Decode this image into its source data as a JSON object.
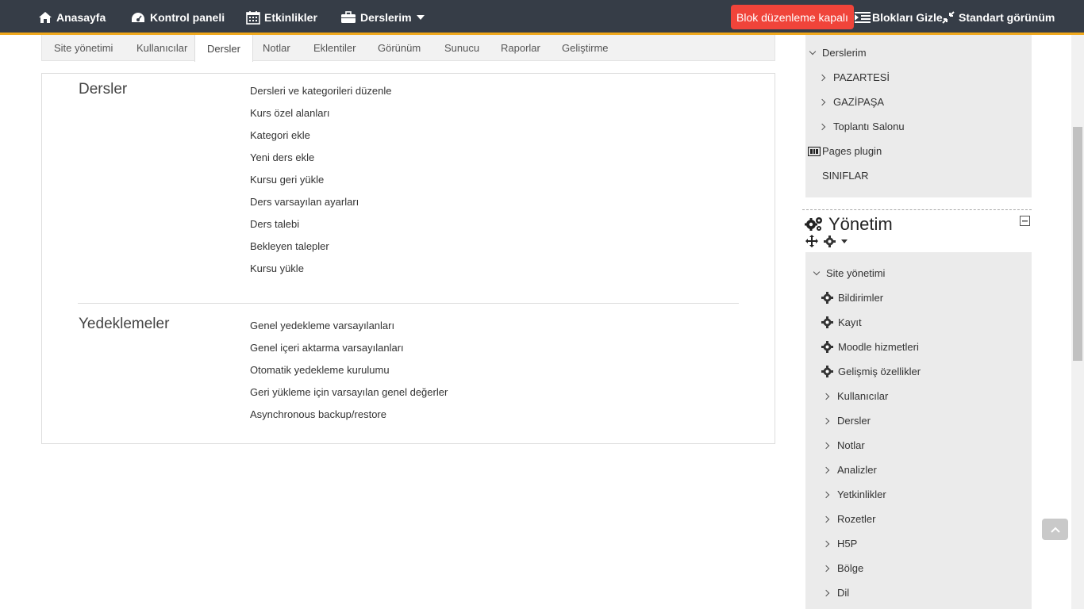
{
  "navbar": {
    "home": "Anasayfa",
    "dashboard": "Kontrol paneli",
    "events": "Etkinlikler",
    "mycourses": "Derslerim",
    "block_edit": "Blok düzenleme kapalı",
    "hide_blocks": "Blokları Gizle",
    "standard_view": "Standart görünüm"
  },
  "tabs": [
    "Site yönetimi",
    "Kullanıcılar",
    "Dersler",
    "Notlar",
    "Eklentiler",
    "Görünüm",
    "Sunucu",
    "Raporlar",
    "Geliştirme"
  ],
  "sections": {
    "courses": {
      "title": "Dersler",
      "links": [
        "Dersleri ve kategorileri düzenle",
        "Kurs özel alanları",
        "Kategori ekle",
        "Yeni ders ekle",
        "Kursu geri yükle",
        "Ders varsayılan ayarları",
        "Ders talebi",
        "Bekleyen talepler",
        "Kursu yükle"
      ]
    },
    "backups": {
      "title": "Yedeklemeler",
      "links": [
        "Genel yedekleme varsayılanları",
        "Genel içeri aktarma varsayılanları",
        "Otomatik yedekleme kurulumu",
        "Geri yükleme için varsayılan genel değerler",
        "Asynchronous backup/restore"
      ]
    }
  },
  "nav_block": {
    "mycourses": "Derslerim",
    "courses": [
      "PAZARTESİ",
      "GAZİPAŞA",
      "Toplantı Salonu"
    ],
    "pages_plugin": "Pages plugin",
    "siniflar": "SINIFLAR"
  },
  "admin_block": {
    "title": "Yönetim",
    "root": "Site yönetimi",
    "gear_items": [
      "Bildirimler",
      "Kayıt",
      "Moodle hizmetleri",
      "Gelişmiş özellikler"
    ],
    "folder_items": [
      "Kullanıcılar",
      "Dersler",
      "Notlar",
      "Analizler",
      "Yetkinlikler",
      "Rozetler",
      "H5P",
      "Bölge",
      "Dil"
    ]
  }
}
